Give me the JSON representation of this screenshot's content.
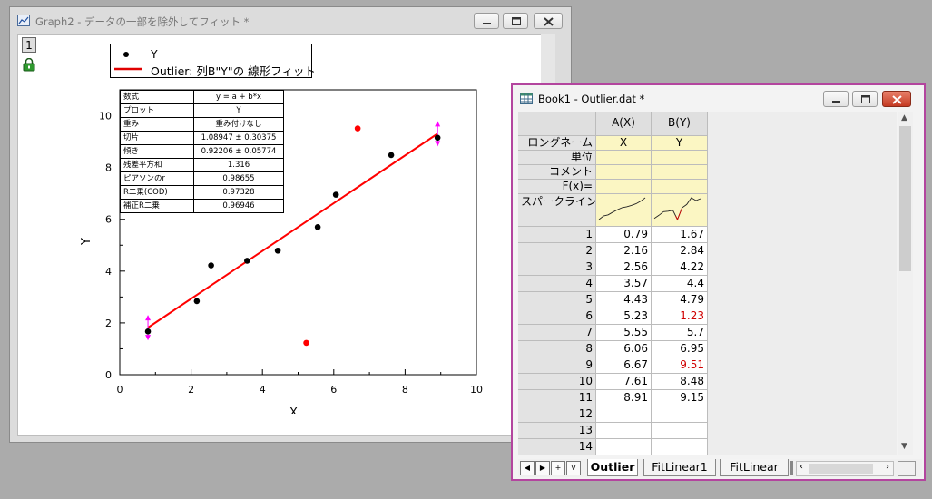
{
  "graph_window": {
    "title": "Graph2 - データの一部を除外してフィット *",
    "layer_number": "1",
    "legend": {
      "series_label": "Y",
      "fit_label": "Outlier: 列B\"Y\"の 線形フィット"
    },
    "results_table": [
      [
        "数式",
        "y = a + b*x"
      ],
      [
        "プロット",
        "Y"
      ],
      [
        "重み",
        "重み付けなし"
      ],
      [
        "切片",
        "1.08947 ± 0.30375"
      ],
      [
        "傾き",
        "0.92206 ± 0.05774"
      ],
      [
        "残差平方和",
        "1.316"
      ],
      [
        "ピアソンのr",
        "0.98655"
      ],
      [
        "R二乗(COD)",
        "0.97328"
      ],
      [
        "補正R二乗",
        "0.96946"
      ]
    ]
  },
  "chart_data": {
    "type": "scatter",
    "xlabel": "X",
    "ylabel": "Y",
    "xlim": [
      0,
      10
    ],
    "ylim": [
      0,
      11
    ],
    "xticks": [
      "0",
      "2",
      "4",
      "6",
      "8",
      "10"
    ],
    "yticks": [
      "0",
      "2",
      "4",
      "6",
      "8",
      "10"
    ],
    "series": [
      {
        "name": "Y",
        "color": "#000000",
        "x": [
          0.79,
          2.16,
          2.56,
          3.57,
          4.43,
          5.55,
          6.06,
          7.61,
          8.91
        ],
        "y": [
          1.67,
          2.84,
          4.22,
          4.4,
          4.79,
          5.7,
          6.95,
          8.48,
          9.15
        ]
      },
      {
        "name": "",
        "color": "#ff0000",
        "x": [
          5.23,
          6.67
        ],
        "y": [
          1.23,
          9.51
        ]
      }
    ],
    "fit_line": {
      "name": "Outlier: 列B\"Y\"の 線形フィット",
      "color": "#ff0000",
      "intercept": 1.08947,
      "slope": 0.92206,
      "x_range": [
        0.79,
        8.91
      ]
    },
    "range_markers": {
      "color": "#ff00ff",
      "x": [
        0.79,
        8.91
      ]
    },
    "legend_position": "top-left"
  },
  "book_window": {
    "title": "Book1 - Outlier.dat *",
    "col_headers": [
      "A(X)",
      "B(Y)"
    ],
    "label_rows": [
      {
        "label": "ロングネーム",
        "values": [
          "X",
          "Y"
        ]
      },
      {
        "label": "単位",
        "values": [
          "",
          ""
        ]
      },
      {
        "label": "コメント",
        "values": [
          "",
          ""
        ]
      },
      {
        "label": "F(x)=",
        "values": [
          "",
          ""
        ]
      },
      {
        "label": "スパークライン",
        "values": [
          "",
          ""
        ]
      }
    ],
    "rows": [
      {
        "n": "1",
        "a": "0.79",
        "b": "1.67",
        "b_color": "#000000"
      },
      {
        "n": "2",
        "a": "2.16",
        "b": "2.84",
        "b_color": "#000000"
      },
      {
        "n": "3",
        "a": "2.56",
        "b": "4.22",
        "b_color": "#000000"
      },
      {
        "n": "4",
        "a": "3.57",
        "b": "4.4",
        "b_color": "#000000"
      },
      {
        "n": "5",
        "a": "4.43",
        "b": "4.79",
        "b_color": "#000000"
      },
      {
        "n": "6",
        "a": "5.23",
        "b": "1.23",
        "b_color": "#d00000"
      },
      {
        "n": "7",
        "a": "5.55",
        "b": "5.7",
        "b_color": "#000000"
      },
      {
        "n": "8",
        "a": "6.06",
        "b": "6.95",
        "b_color": "#000000"
      },
      {
        "n": "9",
        "a": "6.67",
        "b": "9.51",
        "b_color": "#d00000"
      },
      {
        "n": "10",
        "a": "7.61",
        "b": "8.48",
        "b_color": "#000000"
      },
      {
        "n": "11",
        "a": "8.91",
        "b": "9.15",
        "b_color": "#000000"
      },
      {
        "n": "12",
        "a": "",
        "b": "",
        "b_color": "#000000"
      },
      {
        "n": "13",
        "a": "",
        "b": "",
        "b_color": "#000000"
      },
      {
        "n": "14",
        "a": "",
        "b": "",
        "b_color": "#000000"
      }
    ],
    "tabs": [
      "Outlier",
      "FitLinear1",
      "FitLinear"
    ],
    "nav_buttons": [
      "◀",
      "▶",
      "+",
      "V"
    ]
  }
}
